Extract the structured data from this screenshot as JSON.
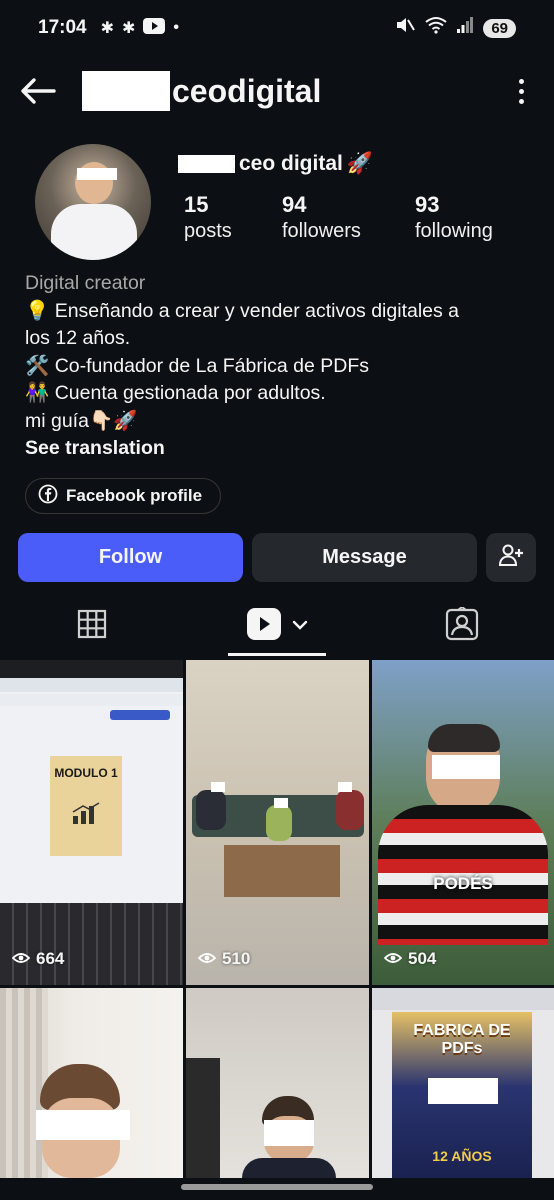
{
  "status_bar": {
    "time": "17:04",
    "battery": "69"
  },
  "header": {
    "username": "ceodigital"
  },
  "profile": {
    "display_name": "ceo digital",
    "stats": [
      {
        "num": "15",
        "label": "posts"
      },
      {
        "num": "94",
        "label": "followers"
      },
      {
        "num": "93",
        "label": "following"
      }
    ],
    "category": "Digital creator",
    "bio_lines": [
      "💡 Enseñando a crear y vender activos digitales a",
      "los 12 años.",
      "🛠️ Co-fundador de La Fábrica de PDFs",
      "👫 Cuenta gestionada por adultos.",
      "mi guía👇🏻🚀"
    ],
    "see_translation": "See translation",
    "facebook_chip": "Facebook profile"
  },
  "actions": {
    "follow": "Follow",
    "message": "Message"
  },
  "grid": {
    "tiles": [
      {
        "views": "664",
        "overlay": "MODULO 1"
      },
      {
        "views": "510",
        "overlay": ""
      },
      {
        "views": "504",
        "overlay": "PODÉS"
      },
      {
        "views": "",
        "overlay": ""
      },
      {
        "views": "",
        "overlay": ""
      },
      {
        "views": "",
        "overlay": "FABRICA DE PDFs"
      }
    ],
    "tile3_caption": "12 AÑOS"
  },
  "colors": {
    "accent": "#4a5df9",
    "background": "#0c1014",
    "secondary_button": "#25292e"
  }
}
